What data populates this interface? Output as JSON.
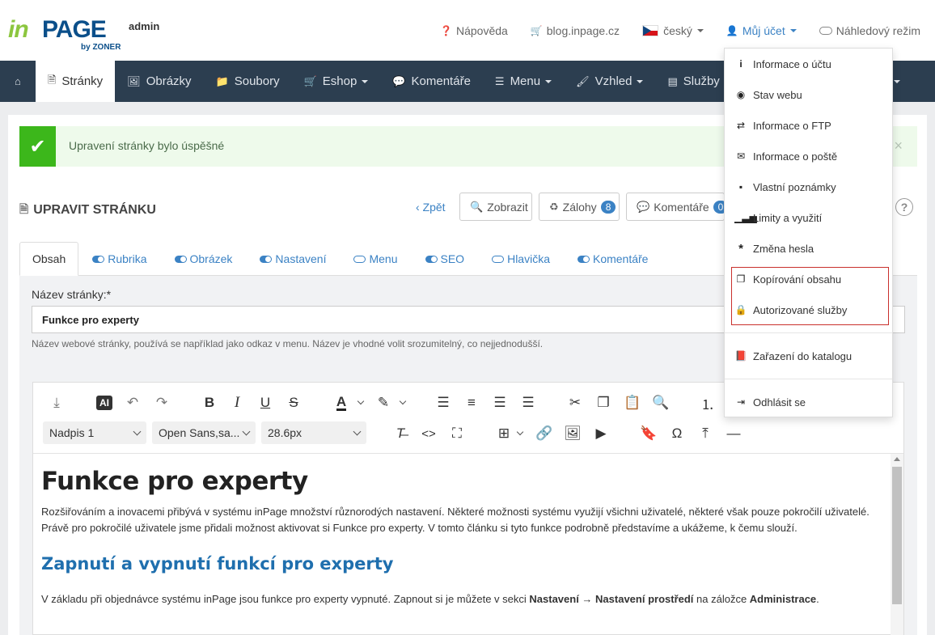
{
  "logo": {
    "part1": "in",
    "part2": "PAGE",
    "by": "by ZONER",
    "admin": "admin"
  },
  "toplinks": {
    "help": "Nápověda",
    "blog": "blog.inpage.cz",
    "language": "český",
    "account": "Můj účet",
    "preview": "Náhledový režim"
  },
  "nav": {
    "items": [
      "Stránky",
      "Obrázky",
      "Soubory",
      "Eshop",
      "Komentáře",
      "Menu",
      "Vzhled",
      "Služby"
    ]
  },
  "alert": {
    "message": "Upravení stránky bylo úspěšné",
    "close": "×"
  },
  "page": {
    "title": "UPRAVIT STRÁNKU",
    "back": "Zpět",
    "view": "Zobrazit",
    "backups": "Zálohy",
    "backups_count": "8",
    "comments": "Komentáře",
    "comments_count": "0",
    "help": "?"
  },
  "tabs": [
    "Obsah",
    "Rubrika",
    "Obrázek",
    "Nastavení",
    "Menu",
    "SEO",
    "Hlavička",
    "Komentáře"
  ],
  "form": {
    "name_label": "Název stránky:*",
    "name_value": "Funkce pro experty",
    "name_help": "Název webové stránky, používá se například jako odkaz v menu. Název je vhodné volit srozumitelný, co nejjednodušší."
  },
  "editor": {
    "ai_label": "AI",
    "format": "Nadpis 1",
    "font": "Open Sans,sa...",
    "size": "28.6px",
    "content": {
      "h1": "Funkce pro experty",
      "p1": "Rozšiřováním a inovacemi přibývá v systému inPage množství různorodých nastavení. Některé možnosti systému využijí všichni uživatelé, některé však pouze pokročilí uživatelé. Právě pro pokročilé uživatele jsme přidali možnost aktivovat si Funkce pro experty. V tomto článku si tyto funkce podrobně představíme a ukážeme, k čemu slouží.",
      "h2": "Zapnutí a vypnutí funkcí pro experty",
      "p2_start": "V základu při objednávce systému inPage jsou funkce pro experty vypnuté. Zapnout si je můžete v sekci ",
      "p2_b1": "Nastavení →  Nastavení prostředí",
      "p2_mid": " na záložce ",
      "p2_b2": "Administrace",
      "p2_end": "."
    }
  },
  "dropdown": {
    "items": [
      "Informace o účtu",
      "Stav webu",
      "Informace o FTP",
      "Informace o poště",
      "Vlastní poznámky",
      "Limity a využití",
      "Změna hesla",
      "Kopírování obsahu",
      "Autorizované služby",
      "Zařazení do katalogu",
      "Odhlásit se"
    ]
  }
}
